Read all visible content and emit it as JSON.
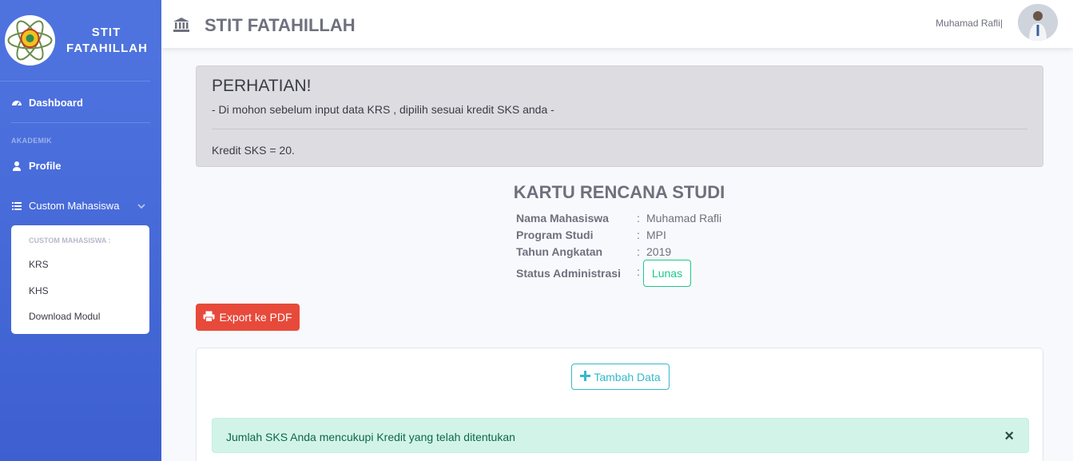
{
  "sidebar": {
    "brand_line1": "STIT",
    "brand_line2": "FATAHILLAH",
    "logo_icon": "atom-emblem-logo",
    "dashboard_label": "Dashboard",
    "section_heading": "AKADEMIK",
    "profile_label": "Profile",
    "custom_label": "Custom Mahasiswa",
    "collapse": {
      "header": "CUSTOM MAHASISWA :",
      "items": [
        "KRS",
        "KHS",
        "Download Modul"
      ]
    },
    "colors": {
      "gradient_top": "#4e73df",
      "gradient_bottom": "#3d5fd0"
    }
  },
  "topbar": {
    "title": "STIT FATAHILLAH",
    "title_icon": "university-icon",
    "user_name": "Muhamad Rafli|"
  },
  "notice": {
    "title": "PERHATIAN!",
    "message": "- Di mohon sebelum input data KRS , dipilih sesuai kredit SKS anda -",
    "credit": "Kredit SKS = 20."
  },
  "krs": {
    "title": "KARTU RENCANA STUDI",
    "fields": [
      {
        "label": "Nama Mahasiswa",
        "value": "Muhamad Rafli"
      },
      {
        "label": "Program Studi",
        "value": "MPI"
      },
      {
        "label": "Tahun Angkatan",
        "value": "2019"
      },
      {
        "label": "Status Administrasi",
        "value": ""
      }
    ],
    "colon": ":",
    "status_badge": "Lunas"
  },
  "actions": {
    "export_label": "Export ke PDF",
    "add_label": "Tambah Data"
  },
  "success_alert": {
    "message": "Jumlah SKS Anda mencukupi Kredit yang telah ditentukan",
    "close": "×"
  },
  "colors": {
    "primary": "#4e73df",
    "danger": "#e74a3b",
    "success": "#1cc88a",
    "info": "#36b9cc"
  }
}
